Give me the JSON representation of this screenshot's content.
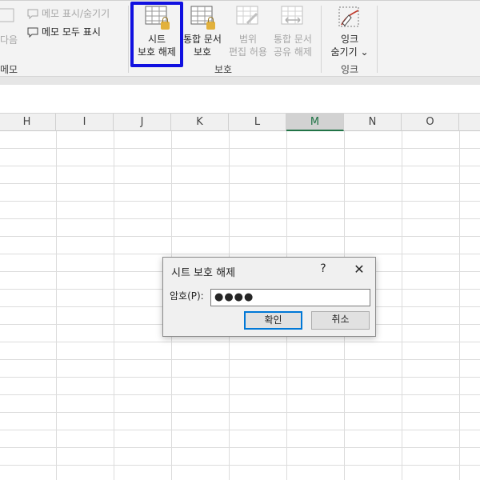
{
  "ribbon": {
    "comments_group": {
      "show_hide_label": "메모 표시/숨기기",
      "show_all_label": "메모 모두 표시",
      "next_label": "다음",
      "group_label": "메모"
    },
    "protect_group": {
      "unprotect_sheet": {
        "line1": "시트",
        "line2": "보호 해제"
      },
      "protect_workbook": {
        "line1": "통합 문서",
        "line2": "보호"
      },
      "allow_edit_ranges": {
        "line1": "범위",
        "line2": "편집 허용"
      },
      "share_workbook": {
        "line1": "통합 문서",
        "line2": "공유 해제"
      },
      "group_label": "보호"
    },
    "ink_group": {
      "hide_ink": {
        "line1": "잉크",
        "line2": "숨기기"
      },
      "group_label": "잉크"
    }
  },
  "columns": [
    "H",
    "I",
    "J",
    "K",
    "L",
    "M",
    "N",
    "O"
  ],
  "active_column": "M",
  "dialog": {
    "title": "시트 보호 해제",
    "help": "?",
    "close": "✕",
    "password_label": "암호(P):",
    "password_value": "●●●●",
    "ok_label": "확인",
    "cancel_label": "취소"
  }
}
